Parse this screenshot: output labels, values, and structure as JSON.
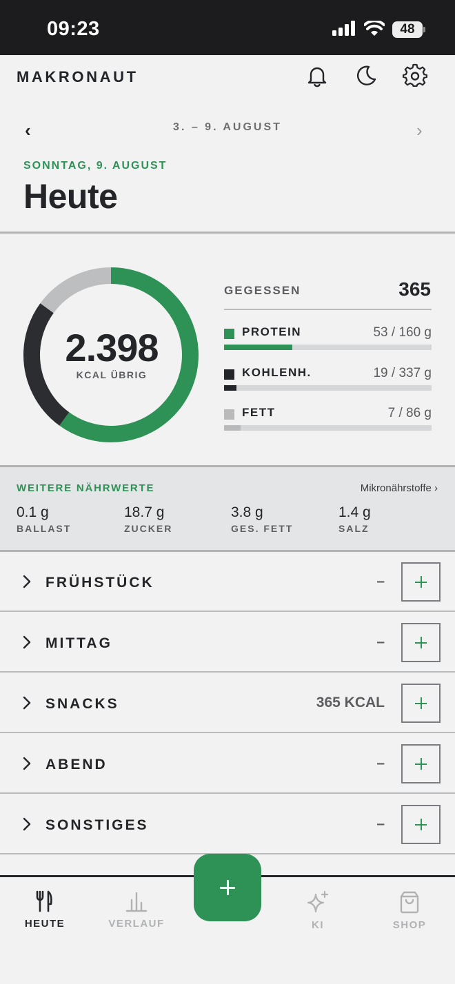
{
  "status_bar": {
    "time": "09:23",
    "battery": "48"
  },
  "header": {
    "brand": "MAKRONAUT"
  },
  "week_nav": {
    "range": "3. – 9. AUGUST"
  },
  "day": {
    "label": "SONNTAG, 9. AUGUST",
    "title": "Heute"
  },
  "summary": {
    "kcal_remaining": "2.398",
    "kcal_label": "KCAL ÜBRIG",
    "ring_progress": {
      "green": 0.6,
      "dark": 0.25,
      "gray": 0.15
    },
    "eaten_label": "GEGESSEN",
    "eaten_value": "365",
    "macros": [
      {
        "name": "PROTEIN",
        "value": "53 / 160 g",
        "fraction": 0.33,
        "color": "#2e9256"
      },
      {
        "name": "KOHLENH.",
        "value": "19 / 337 g",
        "fraction": 0.06,
        "color": "#232528"
      },
      {
        "name": "FETT",
        "value": "7 / 86 g",
        "fraction": 0.08,
        "color": "#b9babc"
      }
    ]
  },
  "nutrients": {
    "title": "WEITERE NÄHRWERTE",
    "link": "Mikronährstoffe ›",
    "items": [
      {
        "value": "0.1 g",
        "label": "BALLAST"
      },
      {
        "value": "18.7 g",
        "label": "ZUCKER"
      },
      {
        "value": "3.8 g",
        "label": "GES. FETT"
      },
      {
        "value": "1.4 g",
        "label": "SALZ"
      }
    ]
  },
  "meals": [
    {
      "label": "FRÜHSTÜCK",
      "kcal": "–"
    },
    {
      "label": "MITTAG",
      "kcal": "–"
    },
    {
      "label": "SNACKS",
      "kcal": "365 KCAL"
    },
    {
      "label": "ABEND",
      "kcal": "–"
    },
    {
      "label": "SONSTIGES",
      "kcal": "–"
    }
  ],
  "tabs": [
    {
      "label": "HEUTE",
      "icon": "fork-knife-icon",
      "active": true
    },
    {
      "label": "VERLAUF",
      "icon": "bar-chart-icon",
      "active": false
    },
    {
      "label": "KI",
      "icon": "sparkle-icon",
      "active": false
    },
    {
      "label": "SHOP",
      "icon": "shopping-bag-icon",
      "active": false
    }
  ],
  "colors": {
    "accent": "#2e9256",
    "dark": "#232528",
    "muted": "#b9babc"
  }
}
